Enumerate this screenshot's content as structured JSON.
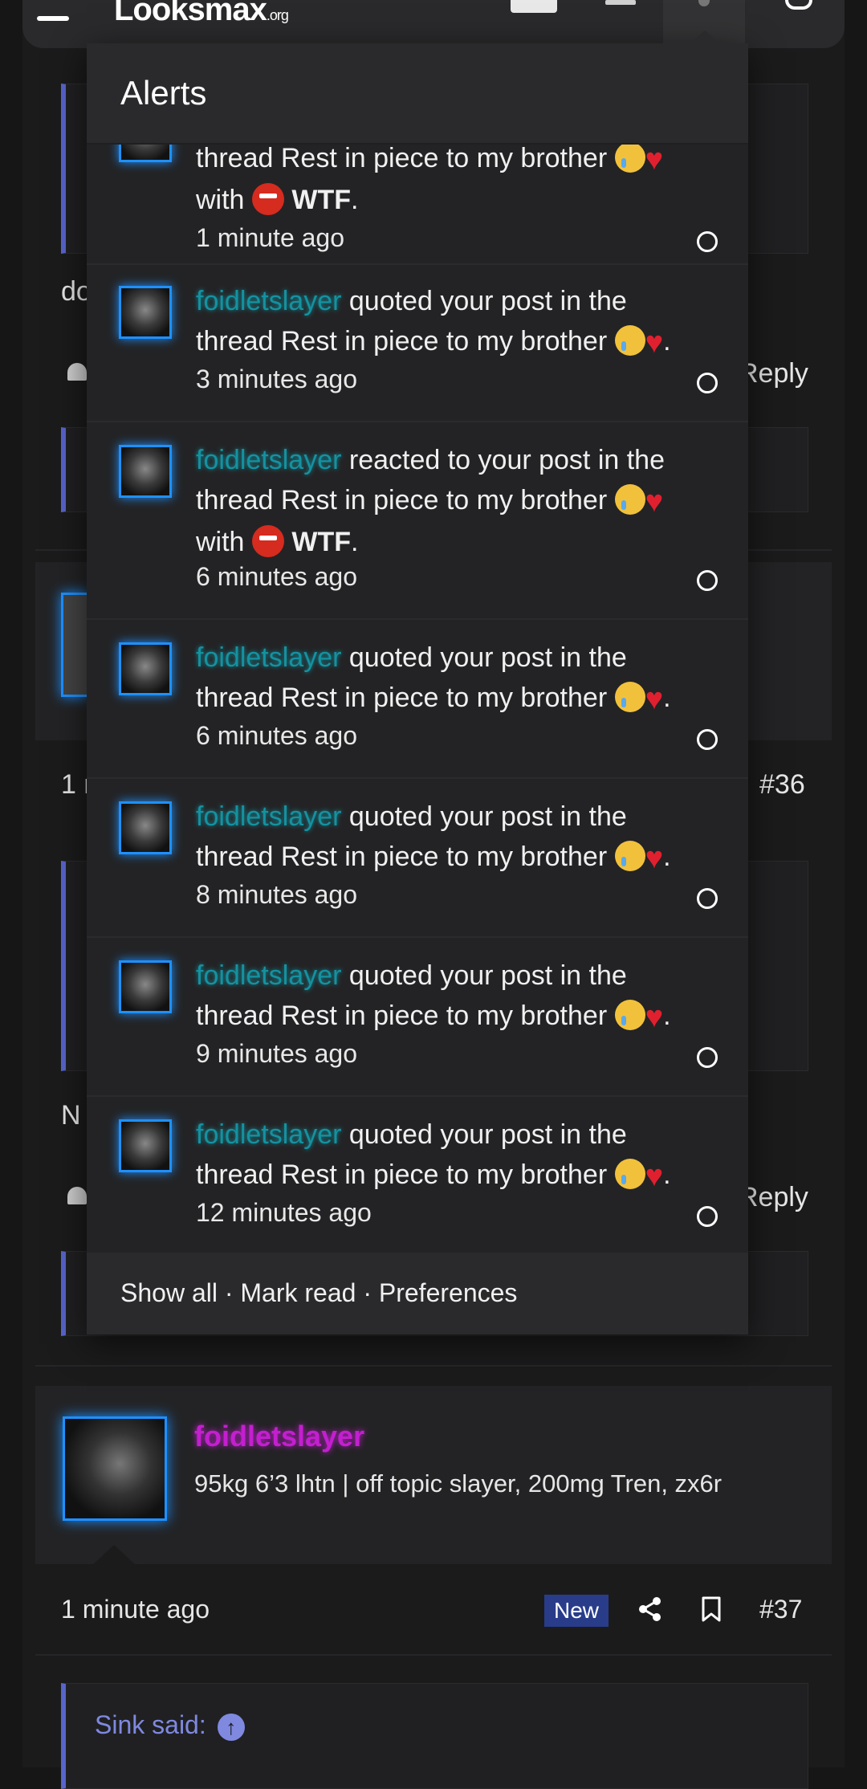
{
  "header": {
    "logo_main": "Looksmax",
    "logo_suffix": ".org"
  },
  "alerts": {
    "title": "Alerts",
    "items": [
      {
        "user": "",
        "action": "",
        "line": "thread Rest in piece to my brother",
        "reaction": "WTF",
        "time": "1 minute ago"
      },
      {
        "user": "foidletslayer",
        "action": "quoted your post in the",
        "line": "thread Rest in piece to my brother",
        "reaction": "",
        "time": "3 minutes ago"
      },
      {
        "user": "foidletslayer",
        "action": "reacted to your post in the",
        "line": "thread Rest in piece to my brother",
        "reaction": "WTF",
        "time": "6 minutes ago"
      },
      {
        "user": "foidletslayer",
        "action": "quoted your post in the",
        "line": "thread Rest in piece to my brother",
        "reaction": "",
        "time": "6 minutes ago"
      },
      {
        "user": "foidletslayer",
        "action": "quoted your post in the",
        "line": "thread Rest in piece to my brother",
        "reaction": "",
        "time": "8 minutes ago"
      },
      {
        "user": "foidletslayer",
        "action": "quoted your post in the",
        "line": "thread Rest in piece to my brother",
        "reaction": "",
        "time": "9 minutes ago"
      },
      {
        "user": "foidletslayer",
        "action": "quoted your post in the",
        "line": "thread Rest in piece to my brother",
        "reaction": "",
        "time": "12 minutes ago"
      }
    ],
    "with_word": "with",
    "footer": {
      "show_all": "Show all",
      "mark_read": "Mark read",
      "preferences": "Preferences",
      "separator": "·"
    }
  },
  "background": {
    "frag_do": "do",
    "reply_1": "Reply",
    "post36_time_fragment": "1 m",
    "post36_number": "#36",
    "frag_n": "N",
    "reply_2": "Reply",
    "post37": {
      "username": "foidletslayer",
      "user_title": "95kg 6’3 lhtn | off topic slayer, 200mg Tren, zx6r",
      "time": "1 minute ago",
      "badge": "New",
      "number": "#37"
    },
    "quote_label": "Sink said:"
  },
  "icons": {
    "menu": "hamburger-icon",
    "bell": "bell-icon",
    "search": "search-icon",
    "share": "share-icon",
    "bookmark": "bookmark-icon",
    "arrow": "arrow-up-icon"
  },
  "colors": {
    "accent": "#5865c9",
    "username_cyan": "#0fb7c9",
    "username_magenta": "#c31fcf",
    "avatar_glow": "#1e90ff",
    "badge": "#283c8a"
  }
}
